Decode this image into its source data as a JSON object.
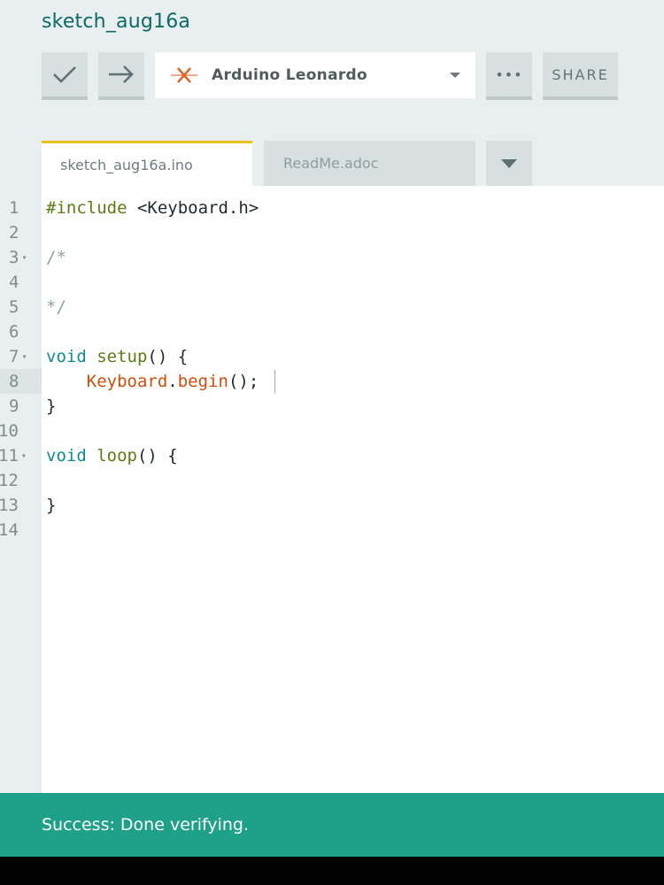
{
  "sketch_title": "sketch_aug16a",
  "toolbar": {
    "verify_icon": "checkmark-icon",
    "upload_icon": "arrow-right-icon",
    "board_icon": "board-disconnected-icon",
    "board_name": "Arduino Leonardo",
    "more_label": "•••",
    "share_label": "SHARE"
  },
  "tabs": [
    {
      "label": "sketch_aug16a.ino",
      "active": true
    },
    {
      "label": "ReadMe.adoc",
      "active": false
    }
  ],
  "editor": {
    "line_numbers": [
      "1",
      "2",
      "3",
      "4",
      "5",
      "6",
      "7",
      "8",
      "9",
      "10",
      "11",
      "12",
      "13",
      "14"
    ],
    "fold_markers": [
      "▾",
      "▾",
      "▾"
    ],
    "active_line": 8,
    "lines": {
      "l1_directive": "#include",
      "l1_header": " <Keyboard.h>",
      "l3": "/*",
      "l5": "*/",
      "l7_type": "void",
      "l7_fn": " setup",
      "l7_rest": "() {",
      "l8_class": "    Keyboard",
      "l8_dot": ".",
      "l8_method": "begin",
      "l8_rest": "();",
      "l9": "}",
      "l11_type": "void",
      "l11_fn": " loop",
      "l11_rest": "() {",
      "l13": "}"
    }
  },
  "status": {
    "message": "Success: Done verifying."
  },
  "colors": {
    "accent_teal": "#0b6a68",
    "status_green": "#1fa089",
    "tab_highlight": "#e6c31e",
    "board_x": "#e0672a"
  }
}
